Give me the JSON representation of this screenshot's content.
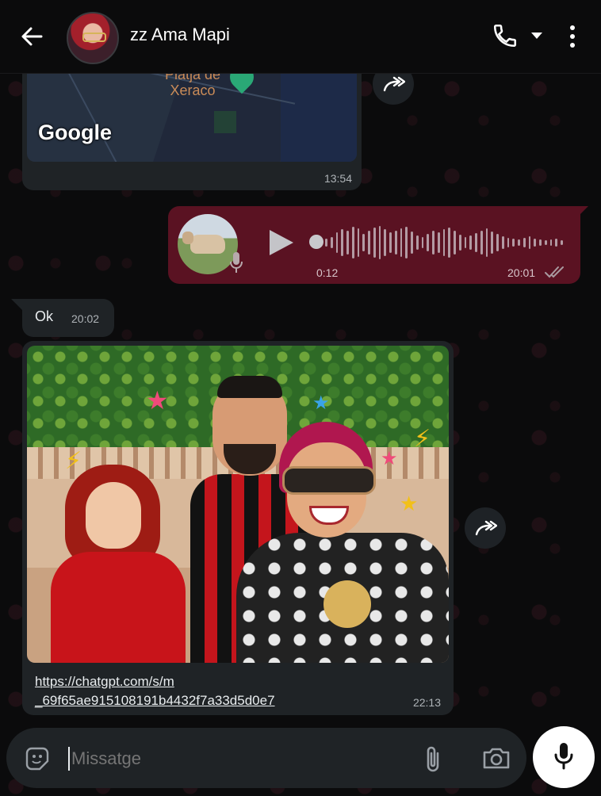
{
  "header": {
    "contact_name": "zz Ama Mapi",
    "icons": [
      "back-arrow-icon",
      "voice-call-icon",
      "dropdown-caret-icon",
      "more-vert-icon"
    ]
  },
  "messages": {
    "map": {
      "place_label": "Platja de\nXeraco",
      "map_brand": "Google",
      "time": "13:54"
    },
    "voice_note": {
      "duration": "0:12",
      "time": "20:01",
      "status": "double-check"
    },
    "ok": {
      "text": "Ok",
      "time": "20:02"
    },
    "image": {
      "link_line1": "https://chatgpt.com/s/m",
      "link_line2": "_69f65ae915108191b4432f7a33d5d0e7",
      "time": "22:13"
    }
  },
  "composer": {
    "placeholder": "Missatge",
    "icons": [
      "sticker-icon",
      "attach-icon",
      "camera-icon",
      "mic-icon"
    ]
  },
  "colors": {
    "outgoing_bubble": "#5a1222",
    "incoming_bubble": "#1f2326",
    "background": "#0b0b0c"
  }
}
